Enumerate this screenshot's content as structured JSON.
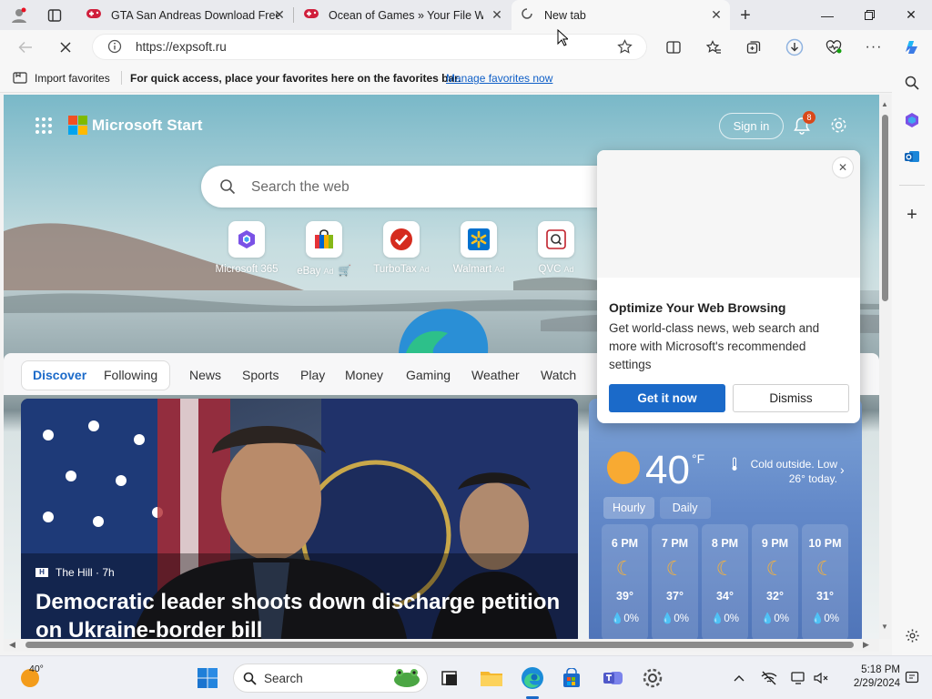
{
  "browser": {
    "tabs": [
      {
        "title": "GTA San Andreas Download Free",
        "icon": "gamepad-icon",
        "active": false
      },
      {
        "title": "Ocean of Games » Your File Will",
        "icon": "gamepad-icon",
        "active": false
      },
      {
        "title": "New tab",
        "icon": "loading-spinner-icon",
        "active": true
      }
    ],
    "address": {
      "url": "https://expsoft.ru"
    },
    "favorites_bar": {
      "import_label": "Import favorites",
      "hint": "For quick access, place your favorites here on the favorites bar.",
      "manage_link": "Manage favorites now"
    },
    "colors": {
      "accent": "#1b6ac9",
      "link": "#0f5fc7"
    }
  },
  "page": {
    "brand": "Microsoft Start",
    "sign_in": "Sign in",
    "notification_count": "8",
    "search": {
      "placeholder": "Search the web"
    },
    "quick_links": [
      {
        "label": "Microsoft 365",
        "ad": ""
      },
      {
        "label": "eBay",
        "ad": "Ad"
      },
      {
        "label": "TurboTax",
        "ad": "Ad"
      },
      {
        "label": "Walmart",
        "ad": "Ad"
      },
      {
        "label": "QVC",
        "ad": "Ad"
      }
    ],
    "nav": [
      "Discover",
      "Following",
      "News",
      "Sports",
      "Play",
      "Money",
      "Gaming",
      "Weather",
      "Watch"
    ],
    "hero": {
      "source": "The Hill · 7h",
      "headline": "Democratic leader shoots down discharge petition on Ukraine-border bill"
    },
    "weather": {
      "temp": "40",
      "unit": "°F",
      "note": "Cold outside. Low 26° today.",
      "tabs": [
        "Hourly",
        "Daily"
      ],
      "hours": [
        {
          "time": "6 PM",
          "temp": "39°",
          "precip": "0%"
        },
        {
          "time": "7 PM",
          "temp": "37°",
          "precip": "0%"
        },
        {
          "time": "8 PM",
          "temp": "34°",
          "precip": "0%"
        },
        {
          "time": "9 PM",
          "temp": "32°",
          "precip": "0%"
        },
        {
          "time": "10 PM",
          "temp": "31°",
          "precip": "0%"
        }
      ]
    },
    "popup": {
      "title": "Optimize Your Web Browsing",
      "body": "Get world-class news, web search and more with Microsoft's recommended settings",
      "primary": "Get it now",
      "secondary": "Dismiss"
    }
  },
  "taskbar": {
    "weather_temp": "40°",
    "search_label": "Search",
    "time": "5:18 PM",
    "date": "2/29/2024"
  }
}
